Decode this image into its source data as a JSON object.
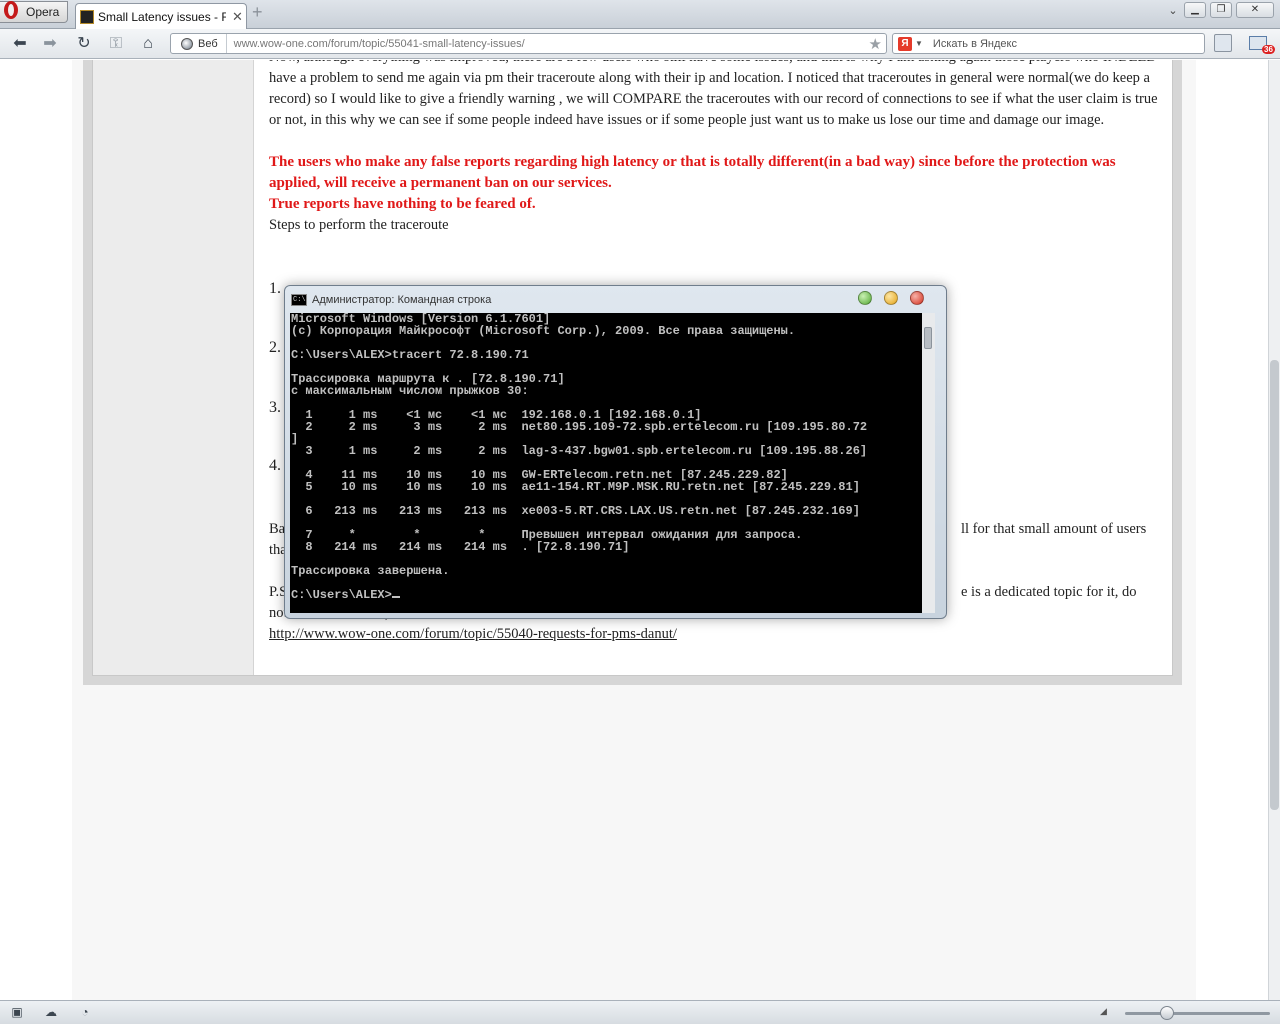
{
  "browser": {
    "menu_label": "Opera",
    "tab_title": "Small Latency issues - F...",
    "tab_close": "✕",
    "new_tab": "+",
    "address_badge": "Веб",
    "url": "www.wow-one.com/forum/topic/55041-small-latency-issues/",
    "search_placeholder": "Искать в Яндекс",
    "search_engine_letter": "Я",
    "mail_count": "36"
  },
  "post": {
    "para1": "Now, although everything was improved, there are a few users who still have some issues, and that is why I am asking again those players who INDEED have a problem to send me again via pm their traceroute along with their ip and location. I noticed that traceroutes in general were normal(we do keep a record) so I would like to give a friendly warning , we will COMPARE the traceroutes with our record of connections to see if what the user claim is true or not, in this why we can see if some people indeed have issues or if some people just want us to make us lose our time and damage our image.",
    "warning1": "The users who make any false reports regarding high latency or that is totally different(in a bad way) since before the protection was applied, will receive a permanent ban on our services.",
    "warning2": "True reports have nothing to be feared of.",
    "steps_heading": "Steps to perform the traceroute",
    "step_numbers": [
      "1.",
      "2.",
      "3.",
      "4."
    ],
    "frag_ba": "Ba",
    "frag_tha": "tha",
    "frag_right1": "ll for that small amount of users",
    "frag_ps": "P.S",
    "frag_right2": "e is a dedicated topic for it, do",
    "frag_notmake": "not make a new one)",
    "link": "http://www.wow-one.com/forum/topic/55040-requests-for-pms-danut/"
  },
  "cmd": {
    "title": "Администратор: Командная строка",
    "icon_text": "C:\\",
    "lines": [
      "Microsoft Windows [Version 6.1.7601]",
      "(c) Корпорация Майкрософт (Microsoft Corp.), 2009. Все права защищены.",
      "",
      "C:\\Users\\ALEX>tracert 72.8.190.71",
      "",
      "Трассировка маршрута к . [72.8.190.71]",
      "с максимальным числом прыжков 30:",
      "",
      "  1     1 ms    <1 мс    <1 мс  192.168.0.1 [192.168.0.1]",
      "  2     2 ms     3 ms     2 ms  net80.195.109-72.spb.ertelecom.ru [109.195.80.72",
      "]",
      "  3     1 ms     2 ms     2 ms  lag-3-437.bgw01.spb.ertelecom.ru [109.195.88.26]",
      "",
      "  4    11 ms    10 ms    10 ms  GW-ERTelecom.retn.net [87.245.229.82]",
      "  5    10 ms    10 ms    10 ms  ae11-154.RT.M9P.MSK.RU.retn.net [87.245.229.81]",
      "",
      "  6   213 ms   213 ms   213 ms  xe003-5.RT.CRS.LAX.US.retn.net [87.245.232.169]",
      "",
      "  7     *        *        *     Превышен интервал ожидания для запроса.",
      "  8   214 ms   214 ms   214 ms  . [72.8.190.71]",
      "",
      "Трассировка завершена.",
      "",
      "C:\\Users\\ALEX>"
    ]
  }
}
